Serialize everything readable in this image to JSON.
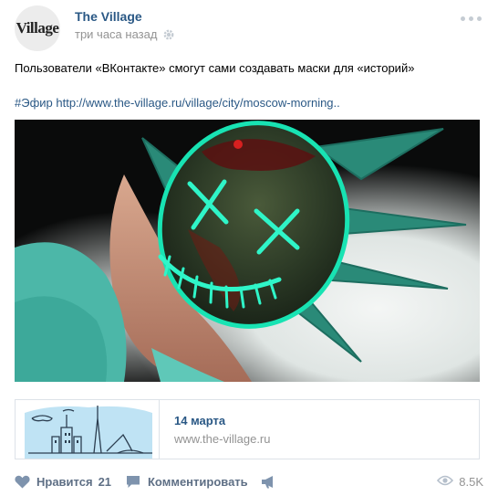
{
  "post": {
    "author": "The Village",
    "avatar_text": "Village",
    "time": "три часа назад",
    "text": "Пользователи «ВКонтакте» смогут сами создавать маски для «историй»",
    "link": "#Эфир http://www.the-village.ru/village/city/moscow-morning..",
    "snippet": {
      "date": "14 марта",
      "domain": "www.the-village.ru"
    },
    "actions": {
      "like_label": "Нравится",
      "like_count": "21",
      "comment_label": "Комментировать",
      "views": "8.5K"
    }
  },
  "colors": {
    "link": "#2a5885",
    "muted": "#939393",
    "action": "#5e6f85",
    "neon": "#23f0c0",
    "thumb_sky": "#bfe3f4"
  },
  "icons": [
    "gear-icon",
    "more-icon",
    "heart-icon",
    "comment-icon",
    "share-icon",
    "eye-icon"
  ]
}
